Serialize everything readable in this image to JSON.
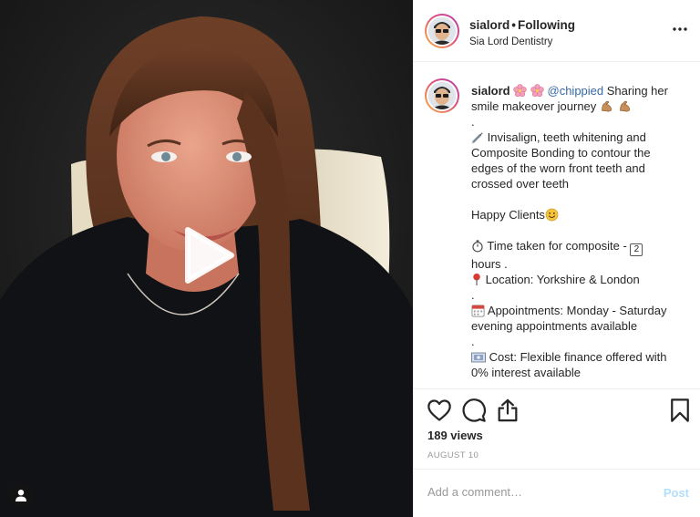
{
  "post": {
    "username": "sialord",
    "separator": "•",
    "follow_status": "Following",
    "location": "Sia Lord Dentistry"
  },
  "caption": {
    "username": "sialord",
    "mention": "@chippied",
    "line1_rest": " Sharing her",
    "line2": "smile makeover journey",
    "dot1": ".",
    "line3": "Invisalign, teeth whitening and",
    "line4": "Composite Bonding to contour the",
    "line5": "edges of the worn front teeth and",
    "line6": "crossed over teeth",
    "line7": "Happy Clients",
    "line8": "Time taken for composite -",
    "line8_badge": "2",
    "line9": "hours .",
    "line10": "Location: Yorkshire & London",
    "dot2": ".",
    "line11": "Appointments: Monday - Saturday",
    "line12": "evening appointments available",
    "dot3": ".",
    "line13": "Cost: Flexible finance offered with",
    "line14": "0% interest available"
  },
  "stats": {
    "views": "189 views",
    "date": "AUGUST 10"
  },
  "comment": {
    "placeholder": "Add a comment…",
    "post_label": "Post"
  },
  "icons": {
    "more": "more-options-icon",
    "like": "heart-icon",
    "comment": "comment-bubble-icon",
    "share": "share-icon",
    "save": "bookmark-icon",
    "play": "play-icon",
    "user_tag": "user-icon"
  },
  "colors": {
    "mention": "#3568a6",
    "post_button_disabled": "#b2dffc",
    "muted_text": "#999999",
    "divider": "#efefef"
  }
}
